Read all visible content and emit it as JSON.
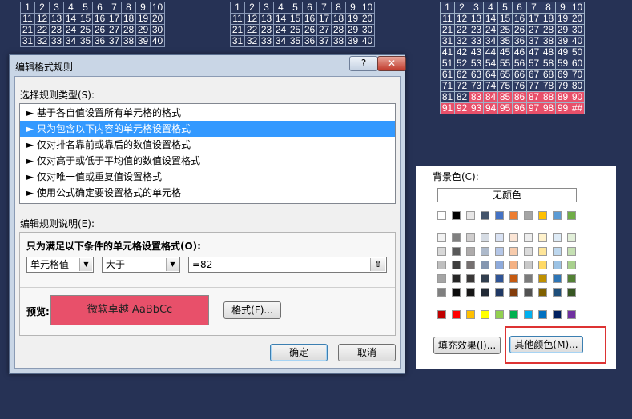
{
  "grid_numbers": [
    "1",
    "2",
    "3",
    "4",
    "5",
    "6",
    "7",
    "8",
    "9",
    "10",
    "11",
    "12",
    "13",
    "14",
    "15",
    "16",
    "17",
    "18",
    "19",
    "20",
    "21",
    "22",
    "23",
    "24",
    "25",
    "26",
    "27",
    "28",
    "29",
    "30",
    "31",
    "32",
    "33",
    "34",
    "35",
    "36",
    "37",
    "38",
    "39",
    "40",
    "41",
    "42",
    "43",
    "44",
    "45",
    "46",
    "47",
    "48",
    "49",
    "50",
    "51",
    "52",
    "53",
    "54",
    "55",
    "56",
    "57",
    "58",
    "59",
    "60",
    "61",
    "62",
    "63",
    "64",
    "65",
    "66",
    "67",
    "68",
    "69",
    "70",
    "71",
    "72",
    "73",
    "74",
    "75",
    "76",
    "77",
    "78",
    "79",
    "80",
    "81",
    "82",
    "83",
    "84",
    "85",
    "86",
    "87",
    "88",
    "89",
    "90",
    "91",
    "92",
    "93",
    "94",
    "95",
    "96",
    "97",
    "98",
    "99",
    "##"
  ],
  "dialog": {
    "title": "编辑格式规则",
    "help_label": "?",
    "close_label": "✕",
    "rule_type_label": "选择规则类型(S):",
    "rule_types": [
      "► 基于各自值设置所有单元格的格式",
      "► 只为包含以下内容的单元格设置格式",
      "► 仅对排名靠前或靠后的数值设置格式",
      "► 仅对高于或低于平均值的数值设置格式",
      "► 仅对唯一值或重复值设置格式",
      "► 使用公式确定要设置格式的单元格"
    ],
    "selected_index": 1,
    "edit_desc_label": "编辑规则说明(E):",
    "condition_heading": "只为满足以下条件的单元格设置格式(O):",
    "cond_field": "单元格值",
    "cond_operator": "大于",
    "cond_value": "=82",
    "preview_label": "预览:",
    "preview_text": "微软卓越  AaBbCc",
    "format_button": "格式(F)...",
    "ok_button": "确定",
    "cancel_button": "取消"
  },
  "color_panel": {
    "background_label": "背景色(C):",
    "no_color": "无颜色",
    "fill_effects": "填充效果(I)...",
    "more_colors": "其他颜色(M)...",
    "theme_top": [
      "#ffffff",
      "#000000",
      "#e7e6e6",
      "#44546a",
      "#4472c4",
      "#ed7d31",
      "#a5a5a5",
      "#ffc000",
      "#5b9bd5",
      "#70ad47"
    ],
    "theme_shades": [
      [
        "#f2f2f2",
        "#808080",
        "#d0cece",
        "#d6dce4",
        "#d9e2f3",
        "#fbe5d5",
        "#ededed",
        "#fff2cc",
        "#deebf6",
        "#e2efd9"
      ],
      [
        "#d8d8d8",
        "#595959",
        "#aeabab",
        "#adb9ca",
        "#b4c6e7",
        "#f7cbac",
        "#dbdbdb",
        "#fee599",
        "#bdd7ee",
        "#c5e0b3"
      ],
      [
        "#bfbfbf",
        "#3f3f3f",
        "#757070",
        "#8496b0",
        "#8eaadb",
        "#f4b183",
        "#c9c9c9",
        "#ffd965",
        "#9cc3e5",
        "#a8d08d"
      ],
      [
        "#a5a5a5",
        "#262626",
        "#3a3838",
        "#323f4f",
        "#2f5496",
        "#c55a11",
        "#7b7b7b",
        "#bf9000",
        "#2e75b5",
        "#538135"
      ],
      [
        "#7f7f7f",
        "#0c0c0c",
        "#171616",
        "#222a35",
        "#1f3864",
        "#833c0b",
        "#525252",
        "#7f6000",
        "#1e4e79",
        "#375623"
      ]
    ],
    "standard": [
      "#c00000",
      "#ff0000",
      "#ffc000",
      "#ffff00",
      "#92d050",
      "#00b050",
      "#00b0f0",
      "#0070c0",
      "#002060",
      "#7030a0"
    ]
  }
}
